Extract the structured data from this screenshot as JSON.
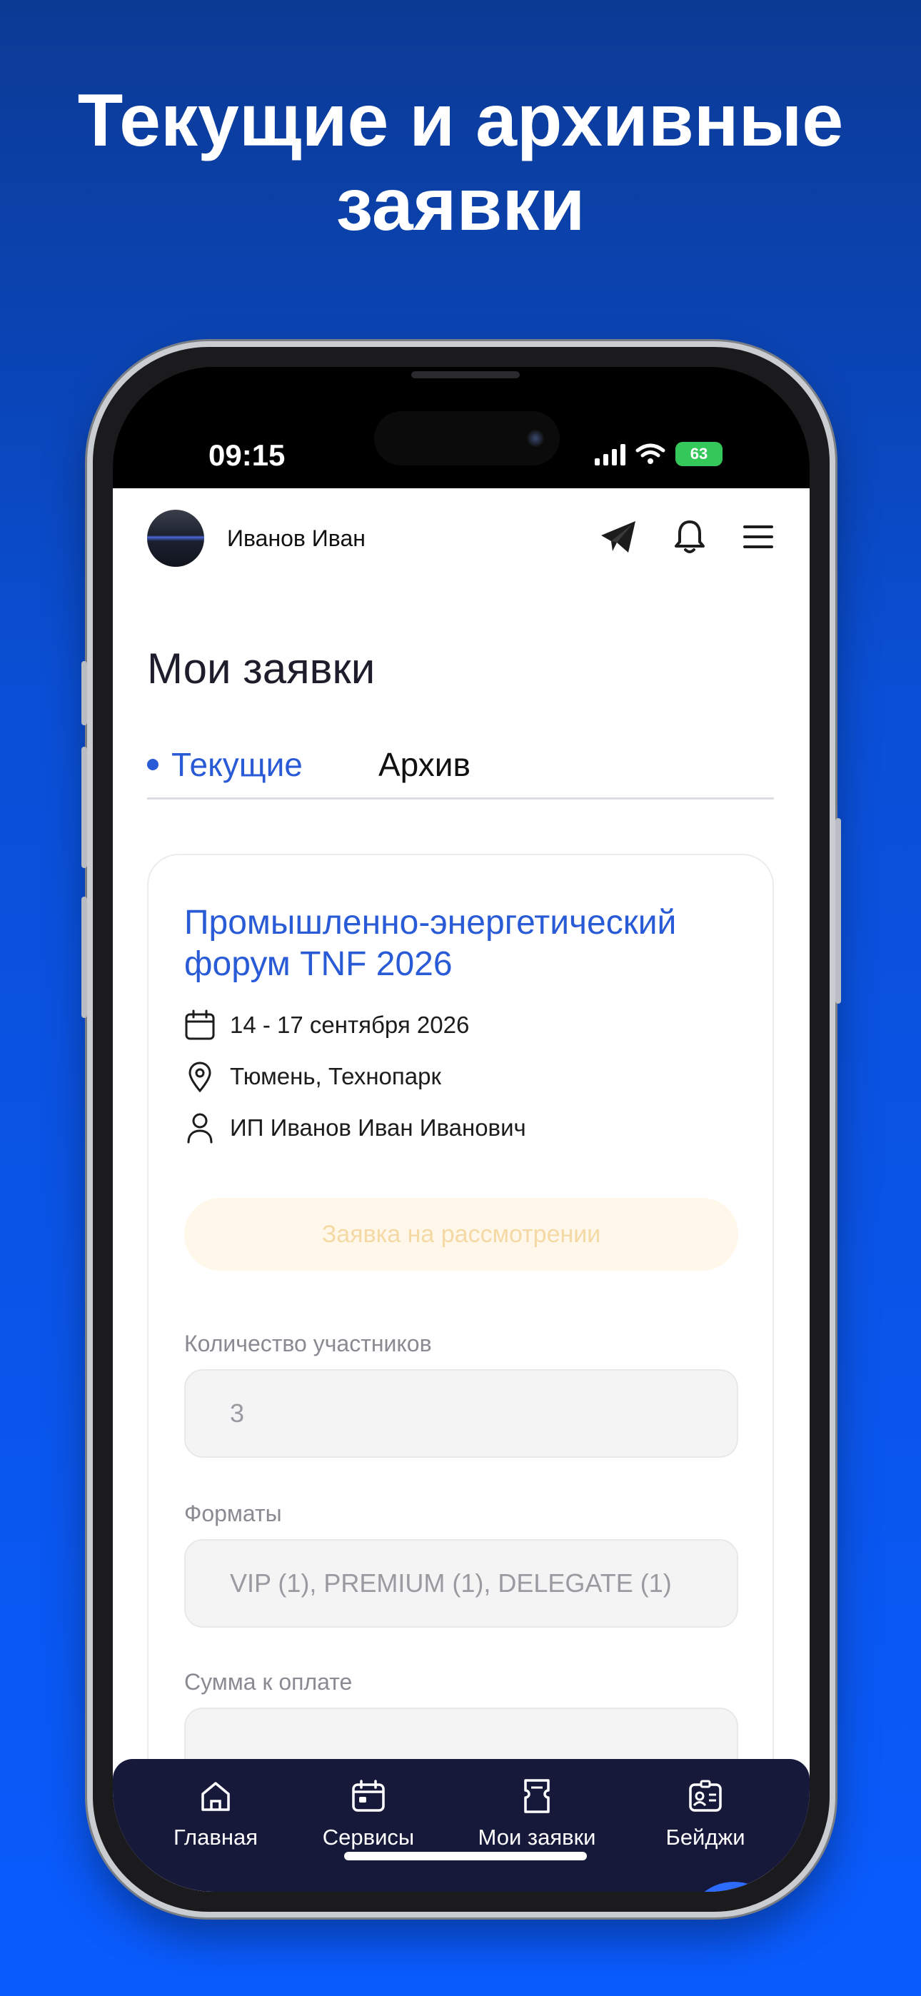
{
  "headline": {
    "line1": "Текущие и архивные",
    "line2": "заявки"
  },
  "status_bar": {
    "time": "09:15",
    "battery": "63",
    "icons": [
      "cellular-signal-icon",
      "wifi-icon",
      "battery-charging-icon"
    ]
  },
  "header": {
    "user_name": "Иванов Иван",
    "icons": [
      "telegram-icon",
      "bell-icon",
      "menu-icon"
    ]
  },
  "page": {
    "title": "Мои заявки",
    "tabs": [
      {
        "label": "Текущие",
        "active": true
      },
      {
        "label": "Архив",
        "active": false
      }
    ]
  },
  "application": {
    "event_title": "Промышленно-энергетический форум TNF 2026",
    "dates": "14 - 17 сентября 2026",
    "location": "Тюмень, Технопарк",
    "applicant": "ИП Иванов Иван Иванович",
    "status": "Заявка на рассмотрении",
    "participants_label": "Количество участников",
    "participants_value": "3",
    "formats_label": "Форматы",
    "formats_value": "VIP (1), PREMIUM (1), DELEGATE (1)",
    "payment_label": "Сумма к оплате"
  },
  "bottom_nav": [
    {
      "label": "Главная",
      "icon": "home-icon"
    },
    {
      "label": "Сервисы",
      "icon": "services-icon"
    },
    {
      "label": "Мои заявки",
      "icon": "tickets-icon"
    },
    {
      "label": "Бейджи",
      "icon": "badge-icon"
    }
  ],
  "colors": {
    "accent": "#2a5bd7",
    "status_text": "#f4d9a4",
    "status_bg": "#fff7e9",
    "nav_bg": "#16193a",
    "fab": "#2d6bff"
  }
}
